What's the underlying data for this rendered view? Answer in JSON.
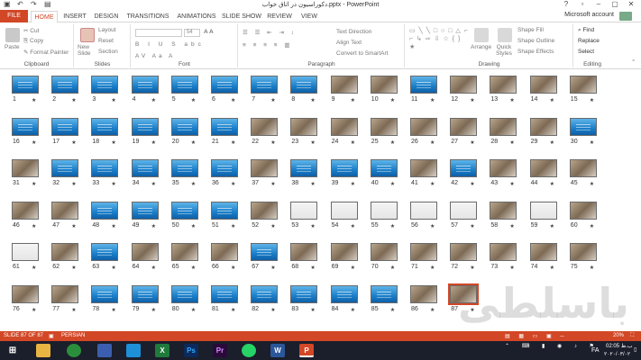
{
  "app": {
    "title": "دکوراسیون در اتاق خواب.pptx - PowerPoint",
    "account": "Microsoft account"
  },
  "window_controls": [
    "?",
    "▫",
    "–",
    "▢",
    "✕"
  ],
  "qat_icons": [
    "save-icon",
    "undo-icon",
    "redo-icon",
    "present-icon"
  ],
  "tabs": [
    "FILE",
    "HOME",
    "INSERT",
    "DESIGN",
    "TRANSITIONS",
    "ANIMATIONS",
    "SLIDE SHOW",
    "REVIEW",
    "VIEW"
  ],
  "active_tab": "HOME",
  "ribbon": {
    "clipboard": {
      "label": "Clipboard",
      "paste": "Paste",
      "cut": "Cut",
      "copy": "Copy",
      "format_painter": "Format Painter"
    },
    "slides": {
      "label": "Slides",
      "new_slide": "New Slide",
      "layout": "Layout",
      "reset": "Reset",
      "section": "Section"
    },
    "font": {
      "label": "Font",
      "font_name": "",
      "font_size": "54"
    },
    "paragraph": {
      "label": "Paragraph",
      "text_direction": "Text Direction",
      "align_text": "Align Text",
      "convert_smartart": "Convert to SmartArt"
    },
    "drawing": {
      "label": "Drawing",
      "arrange": "Arrange",
      "quick_styles": "Quick Styles",
      "shape_fill": "Shape Fill",
      "shape_outline": "Shape Outline",
      "shape_effects": "Shape Effects"
    },
    "editing": {
      "label": "Editing",
      "find": "Find",
      "replace": "Replace",
      "select": "Select"
    }
  },
  "slides": {
    "total": 87,
    "photo_slides": [
      9,
      10,
      12,
      13,
      14,
      15,
      22,
      23,
      24,
      25,
      26,
      27,
      28,
      29,
      31,
      37,
      41,
      43,
      44,
      45,
      46,
      47,
      52,
      56,
      57,
      58,
      59,
      60,
      62,
      64,
      65,
      66,
      68,
      69,
      70,
      71,
      72,
      73,
      74,
      75,
      76,
      77,
      86,
      87
    ],
    "white_slides": [
      53,
      54,
      55,
      56,
      57,
      59,
      61
    ]
  },
  "status": {
    "slide_info": "SLIDE 87 OF 87",
    "language": "PERSIAN",
    "zoom": "20%"
  },
  "taskbar": {
    "apps": [
      "Start",
      "Explorer",
      "Chrome",
      "Store",
      "Excel",
      "Photoshop",
      "Premiere",
      "WhatsApp",
      "Word",
      "PowerPoint"
    ],
    "lang": "FA",
    "time": "02:05 ب.ظ",
    "date": "۲۰۲۰/۰۳/۰۲"
  },
  "watermark": "باسلطی"
}
